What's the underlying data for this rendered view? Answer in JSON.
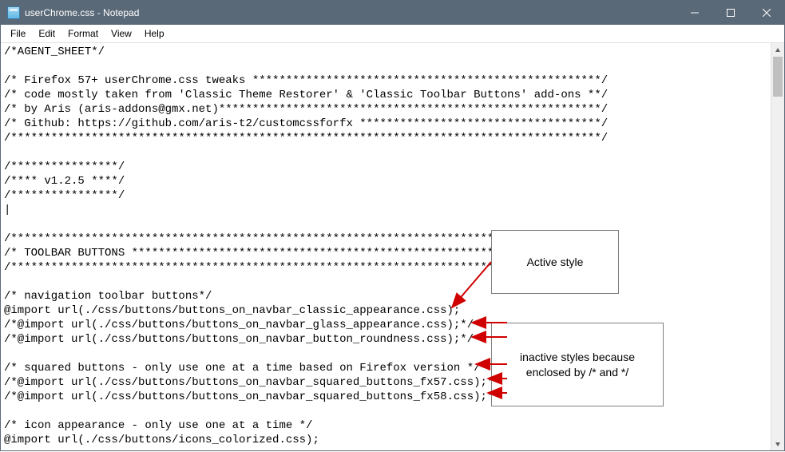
{
  "titlebar": {
    "title": "userChrome.css - Notepad"
  },
  "menubar": {
    "items": [
      "File",
      "Edit",
      "Format",
      "View",
      "Help"
    ]
  },
  "editor": {
    "text": "/*AGENT_SHEET*/\n\n/* Firefox 57+ userChrome.css tweaks ****************************************************/\n/* code mostly taken from 'Classic Theme Restorer' & 'Classic Toolbar Buttons' add-ons **/\n/* by Aris (aris-addons@gmx.net)*********************************************************/\n/* Github: https://github.com/aris-t2/customcssforfx ************************************/\n/****************************************************************************************/\n\n/****************/\n/**** v1.2.5 ****/\n/****************/\n|\n\n/****************************************************************************************/\n/* TOOLBAR BUTTONS **********************************************************************/\n/****************************************************************************************/\n\n/* navigation toolbar buttons*/\n@import url(./css/buttons/buttons_on_navbar_classic_appearance.css);\n/*@import url(./css/buttons/buttons_on_navbar_glass_appearance.css);*/\n/*@import url(./css/buttons/buttons_on_navbar_button_roundness.css);*/\n\n/* squared buttons - only use one at a time based on Firefox version */\n/*@import url(./css/buttons/buttons_on_navbar_squared_buttons_fx57.css);*/\n/*@import url(./css/buttons/buttons_on_navbar_squared_buttons_fx58.css);*/\n\n/* icon appearance - only use one at a time */\n@import url(./css/buttons/icons_colorized.css);"
  },
  "callouts": {
    "active": "Active style",
    "inactive": "inactive styles because enclosed by /* and */"
  }
}
